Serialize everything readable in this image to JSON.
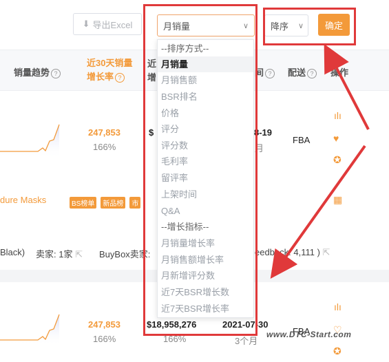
{
  "toolbar": {
    "export_label": "导出Excel",
    "sort_field_value": "月销量",
    "sort_order_value": "降序",
    "confirm_label": "确定"
  },
  "table_header": {
    "sales_trend": "销量趋势",
    "growth_30d_line1": "近30天销量",
    "growth_30d_line2": "增长率",
    "revenue_partial_line1": "近",
    "revenue_partial_line2": "增",
    "date_partial": "间",
    "delivery": "配送",
    "action_partial": "操作"
  },
  "rows": [
    {
      "sales": "247,853",
      "growth": "166%",
      "date_partial": "8-19",
      "date_sub": "月",
      "revenue_partial": "$",
      "delivery": "FBA"
    },
    {
      "sales": "247,853",
      "growth": "166%",
      "revenue": "$18,958,276",
      "revenue_growth": "166%",
      "date": "2021-07-30",
      "date_sub": "3个月",
      "delivery": "FBA"
    }
  ],
  "product": {
    "title_partial": "dure Masks",
    "tags": [
      "BS榜单",
      "新品榜",
      "市"
    ],
    "color_partial": "Black)",
    "seller_label": "卖家: 1家",
    "buybox_label": "BuyBox卖家:",
    "feedback_partial": "eedback: 4,111 )"
  },
  "dropdown": {
    "items": [
      {
        "label": "--排序方式--",
        "type": "group"
      },
      {
        "label": "月销量",
        "type": "selected"
      },
      {
        "label": "月销售额",
        "type": "option"
      },
      {
        "label": "BSR排名",
        "type": "option"
      },
      {
        "label": "价格",
        "type": "option"
      },
      {
        "label": "评分",
        "type": "option"
      },
      {
        "label": "评分数",
        "type": "option"
      },
      {
        "label": "毛利率",
        "type": "option"
      },
      {
        "label": "留评率",
        "type": "option"
      },
      {
        "label": "上架时间",
        "type": "option"
      },
      {
        "label": "Q&A",
        "type": "option"
      },
      {
        "label": "--增长指标--",
        "type": "group"
      },
      {
        "label": "月销量增长率",
        "type": "option"
      },
      {
        "label": "月销售额增长率",
        "type": "option"
      },
      {
        "label": "月新增评分数",
        "type": "option"
      },
      {
        "label": "近7天BSR增长数",
        "type": "option"
      },
      {
        "label": "近7天BSR增长率",
        "type": "option"
      }
    ]
  },
  "watermark": "www.DTC-Start.com",
  "colors": {
    "accent": "#f39a3a",
    "annotation_red": "#e0393a"
  }
}
